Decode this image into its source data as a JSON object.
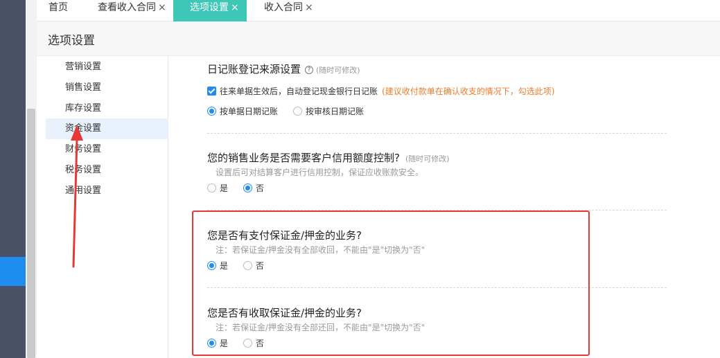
{
  "tabs": [
    {
      "label": "首页",
      "closable": false,
      "active": false
    },
    {
      "label": "查看收入合同",
      "closable": true,
      "active": false
    },
    {
      "label": "选项设置",
      "closable": true,
      "active": true
    },
    {
      "label": "收入合同",
      "closable": true,
      "active": false
    }
  ],
  "close_glyph": "×",
  "page": {
    "title": "选项设置"
  },
  "nav": {
    "items": [
      "营销设置",
      "销售设置",
      "库存设置",
      "资金设置",
      "财务设置",
      "税务设置",
      "通用设置"
    ],
    "active_index": 3
  },
  "journal": {
    "title": "日记账登记来源设置",
    "help": "?",
    "hint": "(随时可修改)",
    "auto_check_label": "往来单据生效后，自动登记现金银行日记账",
    "auto_check_note": "(建议收付款单在确认收支的情况下，勾选此项)",
    "auto_checked": true,
    "radio_a": "按单据日期记账",
    "radio_b": "按审核日期记账",
    "selected": "a"
  },
  "credit": {
    "title": "您的销售业务是否需要客户信用额度控制?",
    "hint": "(随时可修改)",
    "desc": "设置后可对结算客户进行信用控制，保证应收账款安全。",
    "yes": "是",
    "no": "否",
    "selected": "no"
  },
  "pay_deposit": {
    "title": "您是否有支付保证金/押金的业务?",
    "desc": "注：若保证金/押金没有全部收回，不能由\"是\"切换为\"否\"",
    "yes": "是",
    "no": "否",
    "selected": "yes"
  },
  "receive_deposit": {
    "title": "您是否有收取保证金/押金的业务?",
    "desc": "注：若保证金/押金没有全部还回，不能由\"是\"切换为\"否\"",
    "yes": "是",
    "no": "否",
    "selected": "yes"
  },
  "colors": {
    "accent": "#1f8cf0",
    "active_tab": "#3ec7b7",
    "warning_text": "#f07b2c",
    "annotation_red": "#e53935"
  }
}
